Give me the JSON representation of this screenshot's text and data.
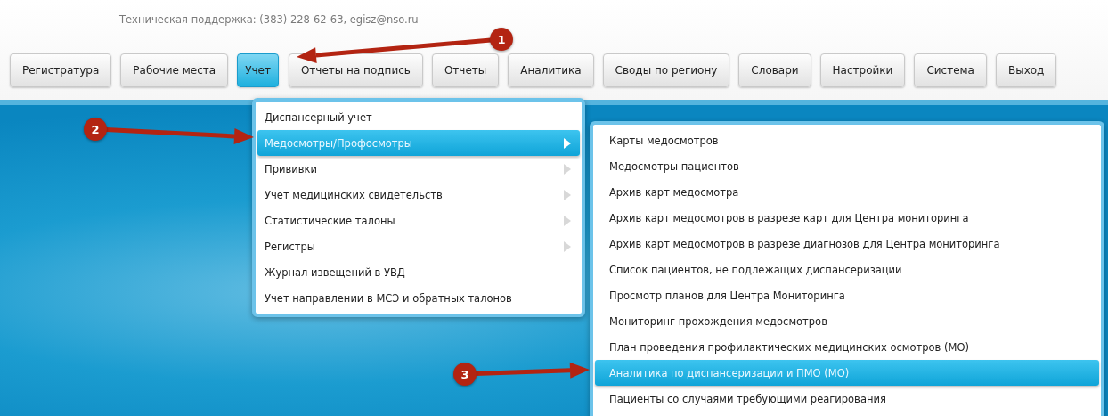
{
  "header": {
    "support": "Техническая поддержка: (383) 228-62-63, egisz@nso.ru"
  },
  "nav": [
    {
      "label": "Регистратура",
      "selected": false
    },
    {
      "label": "Рабочие места",
      "selected": false
    },
    {
      "label": "Учет",
      "selected": true
    },
    {
      "label": "Отчеты на подпись",
      "selected": false
    },
    {
      "label": "Отчеты",
      "selected": false
    },
    {
      "label": "Аналитика",
      "selected": false
    },
    {
      "label": "Своды по региону",
      "selected": false
    },
    {
      "label": "Словари",
      "selected": false
    },
    {
      "label": "Настройки",
      "selected": false
    },
    {
      "label": "Система",
      "selected": false
    },
    {
      "label": "Выход",
      "selected": false
    }
  ],
  "menu": [
    {
      "label": "Диспансерный учет",
      "selected": false,
      "has_submenu": false
    },
    {
      "label": "Медосмотры/Профосмотры",
      "selected": true,
      "has_submenu": true
    },
    {
      "label": "Прививки",
      "selected": false,
      "has_submenu": true
    },
    {
      "label": "Учет медицинских свидетельств",
      "selected": false,
      "has_submenu": true
    },
    {
      "label": "Статистические талоны",
      "selected": false,
      "has_submenu": true
    },
    {
      "label": "Регистры",
      "selected": false,
      "has_submenu": true
    },
    {
      "label": "Журнал извещений в УВД",
      "selected": false,
      "has_submenu": false
    },
    {
      "label": "Учет направлении в МСЭ и обратных талонов",
      "selected": false,
      "has_submenu": false
    }
  ],
  "submenu": [
    {
      "label": "Карты медосмотров",
      "selected": false
    },
    {
      "label": "Медосмотры пациентов",
      "selected": false
    },
    {
      "label": "Архив карт медосмотра",
      "selected": false
    },
    {
      "label": "Архив карт медосмотров в разрезе карт для Центра мониторинга",
      "selected": false
    },
    {
      "label": "Архив карт медосмотров в разрезе диагнозов для Центра мониторинга",
      "selected": false
    },
    {
      "label": "Список пациентов, не подлежащих диспансеризации",
      "selected": false
    },
    {
      "label": "Просмотр планов для Центра Мониторинга",
      "selected": false
    },
    {
      "label": "Мониторинг прохождения медосмотров",
      "selected": false
    },
    {
      "label": "План проведения профилактических медицинских осмотров (МО)",
      "selected": false
    },
    {
      "label": "Аналитика по диспансеризации и ПМО (МО)",
      "selected": true
    },
    {
      "label": "Пациенты со случаями требующими реагирования",
      "selected": false
    }
  ],
  "annotations": [
    {
      "number": "1"
    },
    {
      "number": "2"
    },
    {
      "number": "3"
    }
  ]
}
